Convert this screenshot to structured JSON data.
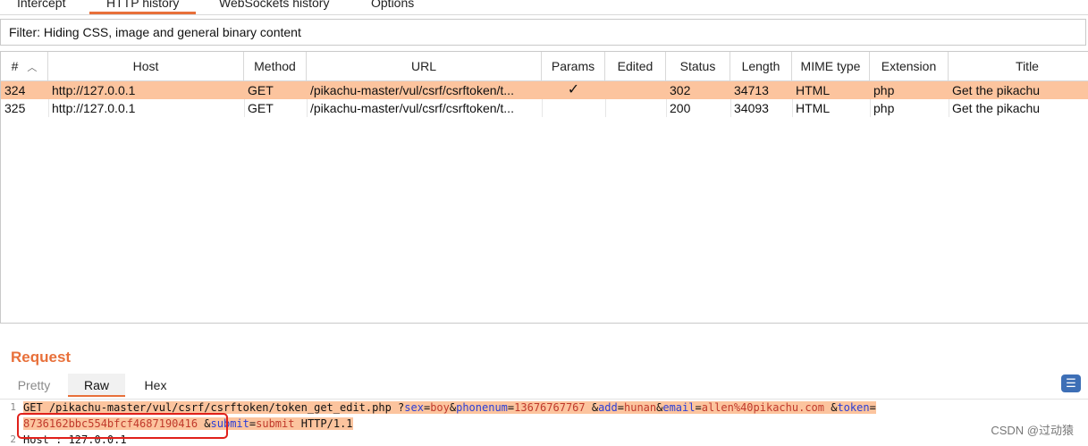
{
  "top_tabs": [
    "Intercept",
    "HTTP history",
    "WebSockets history",
    "Options"
  ],
  "active_top_tab": "HTTP history",
  "filter_text": "Filter: Hiding CSS, image and general binary content",
  "columns": [
    "#",
    "Host",
    "Method",
    "URL",
    "Params",
    "Edited",
    "Status",
    "Length",
    "MIME type",
    "Extension",
    "Title"
  ],
  "rows": [
    {
      "num": "324",
      "host": "http://127.0.0.1",
      "method": "GET",
      "url": "/pikachu-master/vul/csrf/csrftoken/t...",
      "params": "✓",
      "edited": "",
      "status": "302",
      "length": "34713",
      "mime": "HTML",
      "ext": "php",
      "title": "Get the pikachu",
      "selected": true
    },
    {
      "num": "325",
      "host": "http://127.0.0.1",
      "method": "GET",
      "url": "/pikachu-master/vul/csrf/csrftoken/t...",
      "params": "",
      "edited": "",
      "status": "200",
      "length": "34093",
      "mime": "HTML",
      "ext": "php",
      "title": "Get the pikachu",
      "selected": false
    }
  ],
  "request_title": "Request",
  "request_tabs": [
    "Pretty",
    "Raw",
    "Hex"
  ],
  "active_request_tab": "Raw",
  "line_numbers": [
    "1",
    "",
    "2"
  ],
  "request_line1_path": "GET /pikachu-master/vul/csrf/csrftoken/token_get_edit.php",
  "params": {
    "p1": "sex",
    "v1": "boy",
    "p2": "phonenum",
    "v2": "13676767767",
    "p3": "add",
    "v3": "hunan",
    "p4": "email",
    "v4": "allen%40pikachu.com",
    "p5": "token",
    "v5": "8736162bbc554bfcf4687190416",
    "p6": "submit",
    "v6": "submit"
  },
  "http_version": "HTTP/1.1",
  "host_line": "Host : 127.0.0.1",
  "watermark": "CSDN @过动猿",
  "colors": {
    "accent": "#e8703a",
    "selected_row": "#fcc49e",
    "highlight_box": "#e0201a",
    "param_name": "#2a3ed6",
    "param_value": "#c0392b"
  }
}
